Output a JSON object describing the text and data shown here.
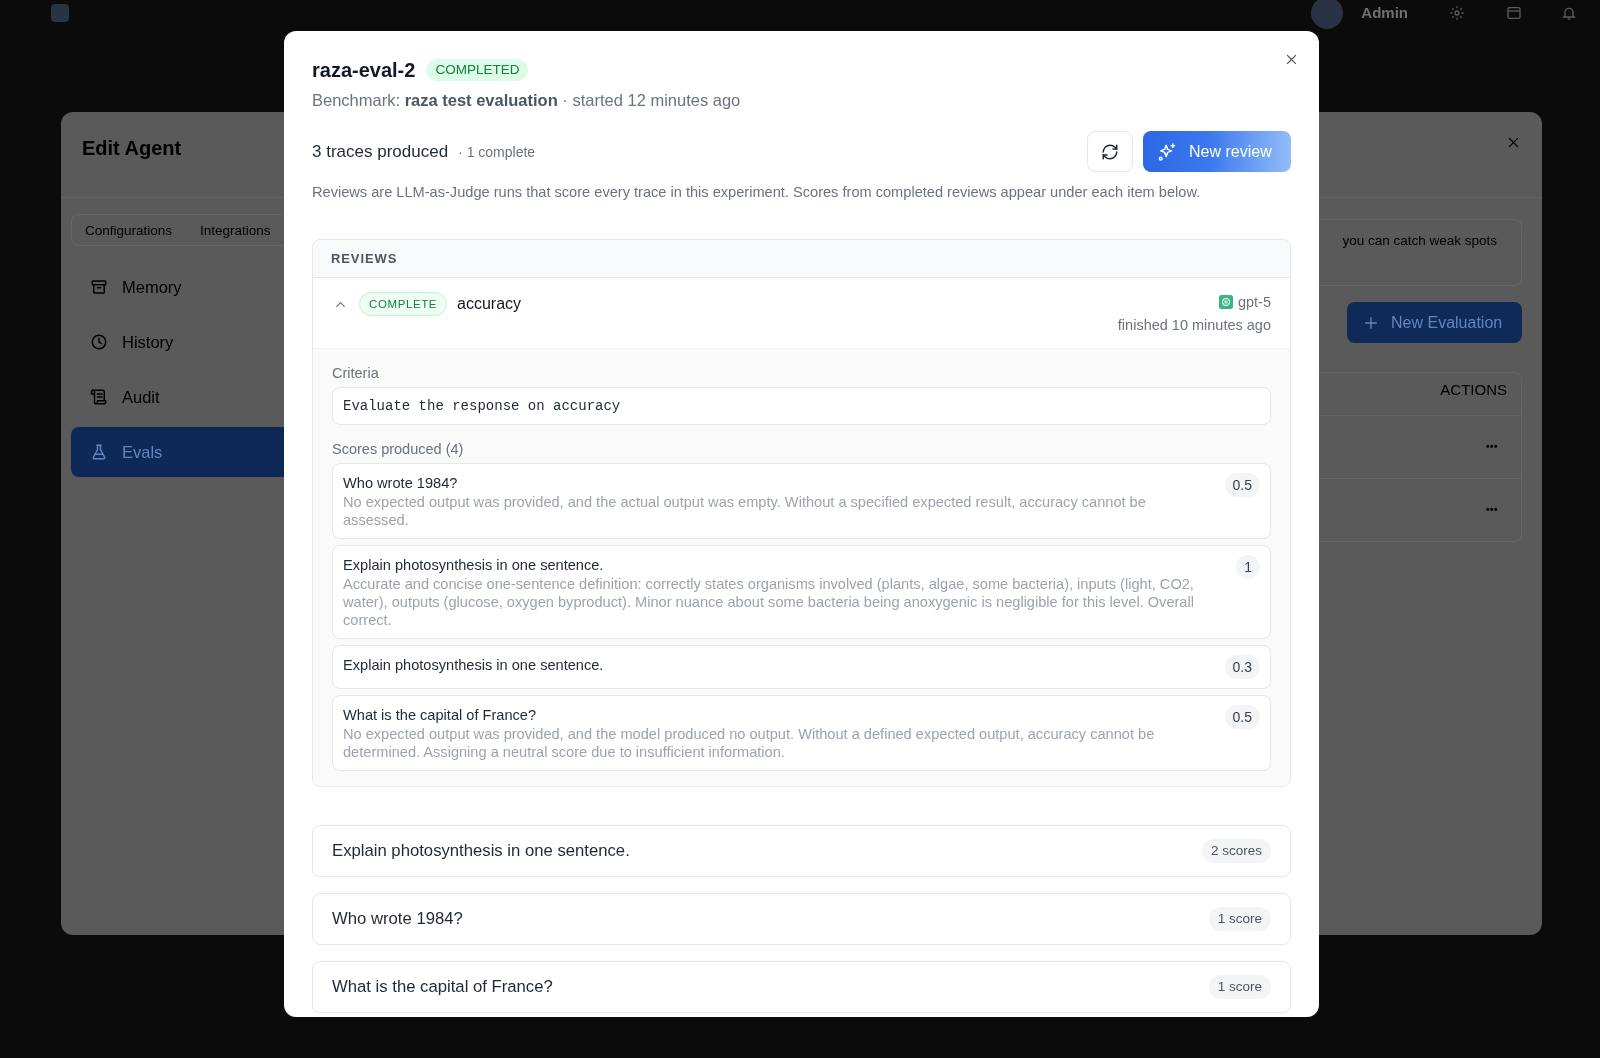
{
  "top_bar": {
    "user": "Admin"
  },
  "edit_agent": {
    "title": "Edit Agent",
    "tabs": [
      {
        "label": "Configurations",
        "selected": false
      },
      {
        "label": "Integrations",
        "selected": false
      }
    ],
    "nav": [
      {
        "label": "Memory",
        "selected": false
      },
      {
        "label": "History",
        "selected": false
      },
      {
        "label": "Audit",
        "selected": false
      },
      {
        "label": "Evals",
        "selected": true
      }
    ],
    "info_text": "you can catch weak spots",
    "new_evaluation": "New Evaluation",
    "table": {
      "columns": [
        "ACTIONS"
      ],
      "rows": [
        {
          "actions": "•••"
        },
        {
          "actions": "•••"
        }
      ]
    }
  },
  "modal": {
    "title": "raza-eval-2",
    "status": "COMPLETED",
    "subtitle": "Benchmark: **raza test evaluation** · started 12 minutes ago",
    "traces": "3 traces produced",
    "complete": "· 1 complete",
    "new_review": "New review",
    "description": "Reviews are LLM-as-Judge runs that score every trace in this experiment. Scores from completed reviews appear under each item below.",
    "reviews": {
      "heading": "REVIEWS",
      "items": [
        {
          "status": "COMPLETE",
          "name": "accuracy",
          "expanded": true,
          "model": "gpt-5",
          "finished": "finished 10 minutes ago",
          "criteria_label": "Criteria",
          "criteria": "Evaluate the response on accuracy",
          "scores_label": "Scores produced (4)",
          "scores": [
            {
              "question": "Who wrote 1984?",
              "reason": "No expected output was provided, and the actual output was empty. Without a specified expected result, accuracy cannot be assessed.",
              "score": "0.5"
            },
            {
              "question": "Explain photosynthesis in one sentence.",
              "reason": "Accurate and concise one-sentence definition: correctly states organisms involved (plants, algae, some bacteria), inputs (light, CO2, water), outputs (glucose, oxygen byproduct). Minor nuance about some bacteria being anoxygenic is negligible for this level. Overall correct.",
              "score": "1"
            },
            {
              "question": "Explain photosynthesis in one sentence.",
              "score": "0.3"
            },
            {
              "question": "What is the capital of France?",
              "reason": "No expected output was provided, and the model produced no output. Without a defined expected output, accuracy cannot be determined. Assigning a neutral score due to insufficient information.",
              "score": "0.5"
            }
          ]
        }
      ]
    },
    "trace_items": [
      {
        "question": "Explain photosynthesis in one sentence.",
        "count": "2 scores"
      },
      {
        "question": "Who wrote 1984?",
        "count": "1 score"
      },
      {
        "question": "What is the capital of France?",
        "count": "1 score"
      }
    ]
  }
}
